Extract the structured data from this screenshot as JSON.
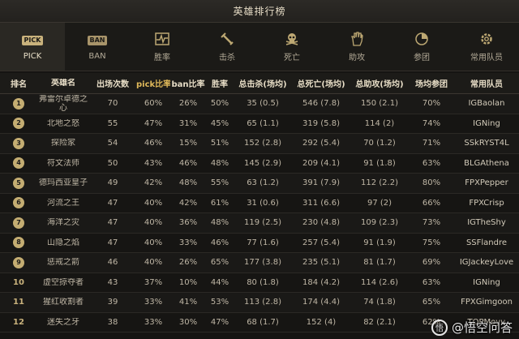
{
  "page_title": "英雄排行榜",
  "tabs": [
    {
      "label": "PICK",
      "icon": "pick-badge-icon",
      "badge": "PICK",
      "active": true
    },
    {
      "label": "BAN",
      "icon": "ban-badge-icon",
      "badge": "BAN",
      "active": false
    },
    {
      "label": "胜率",
      "icon": "pulse-chart-icon",
      "active": false
    },
    {
      "label": "击杀",
      "icon": "sword-icon",
      "active": false
    },
    {
      "label": "死亡",
      "icon": "skull-icon",
      "active": false
    },
    {
      "label": "助攻",
      "icon": "hand-icon",
      "active": false
    },
    {
      "label": "参团",
      "icon": "pie-chart-icon",
      "active": false
    },
    {
      "label": "常用队员",
      "icon": "gear-icon",
      "active": false
    }
  ],
  "table": {
    "headers": [
      "排名",
      "英雄名",
      "出场次数",
      "pick比率",
      "ban比率",
      "胜率",
      "总击杀(场均)",
      "总死亡(场均)",
      "总助攻(场均)",
      "场均参团",
      "常用队员"
    ],
    "rows": [
      {
        "rank": "1",
        "name": "弗雷尔卓德之心",
        "picks": "70",
        "pick_rate": "60%",
        "ban_rate": "26%",
        "win_rate": "50%",
        "kills": "35 (0.5)",
        "deaths": "546 (7.8)",
        "assists": "150 (2.1)",
        "participation": "70%",
        "team": "IGBaolan"
      },
      {
        "rank": "2",
        "name": "北地之怒",
        "picks": "55",
        "pick_rate": "47%",
        "ban_rate": "31%",
        "win_rate": "45%",
        "kills": "65 (1.1)",
        "deaths": "319 (5.8)",
        "assists": "114 (2)",
        "participation": "74%",
        "team": "IGNing"
      },
      {
        "rank": "3",
        "name": "探险家",
        "picks": "54",
        "pick_rate": "46%",
        "ban_rate": "15%",
        "win_rate": "51%",
        "kills": "152 (2.8)",
        "deaths": "292 (5.4)",
        "assists": "70 (1.2)",
        "participation": "71%",
        "team": "SSkRYST4L"
      },
      {
        "rank": "4",
        "name": "符文法师",
        "picks": "50",
        "pick_rate": "43%",
        "ban_rate": "46%",
        "win_rate": "48%",
        "kills": "145 (2.9)",
        "deaths": "209 (4.1)",
        "assists": "91 (1.8)",
        "participation": "63%",
        "team": "BLGAthena"
      },
      {
        "rank": "5",
        "name": "德玛西亚皇子",
        "picks": "49",
        "pick_rate": "42%",
        "ban_rate": "48%",
        "win_rate": "55%",
        "kills": "63 (1.2)",
        "deaths": "391 (7.9)",
        "assists": "112 (2.2)",
        "participation": "80%",
        "team": "FPXPepper"
      },
      {
        "rank": "6",
        "name": "河流之王",
        "picks": "47",
        "pick_rate": "40%",
        "ban_rate": "42%",
        "win_rate": "61%",
        "kills": "31 (0.6)",
        "deaths": "311 (6.6)",
        "assists": "97 (2)",
        "participation": "66%",
        "team": "FPXCrisp"
      },
      {
        "rank": "7",
        "name": "海洋之灾",
        "picks": "47",
        "pick_rate": "40%",
        "ban_rate": "36%",
        "win_rate": "48%",
        "kills": "119 (2.5)",
        "deaths": "230 (4.8)",
        "assists": "109 (2.3)",
        "participation": "73%",
        "team": "IGTheShy"
      },
      {
        "rank": "8",
        "name": "山隐之焰",
        "picks": "47",
        "pick_rate": "40%",
        "ban_rate": "33%",
        "win_rate": "46%",
        "kills": "77 (1.6)",
        "deaths": "257 (5.4)",
        "assists": "91 (1.9)",
        "participation": "75%",
        "team": "SSFlandre"
      },
      {
        "rank": "9",
        "name": "惩戒之箭",
        "picks": "46",
        "pick_rate": "40%",
        "ban_rate": "26%",
        "win_rate": "65%",
        "kills": "177 (3.8)",
        "deaths": "235 (5.1)",
        "assists": "81 (1.7)",
        "participation": "69%",
        "team": "IGJackeyLove"
      },
      {
        "rank": "10",
        "name": "虚空掠夺者",
        "picks": "43",
        "pick_rate": "37%",
        "ban_rate": "10%",
        "win_rate": "44%",
        "kills": "80 (1.8)",
        "deaths": "184 (4.2)",
        "assists": "114 (2.6)",
        "participation": "63%",
        "team": "IGNing"
      },
      {
        "rank": "11",
        "name": "猩红收割者",
        "picks": "39",
        "pick_rate": "33%",
        "ban_rate": "41%",
        "win_rate": "53%",
        "kills": "113 (2.8)",
        "deaths": "174 (4.4)",
        "assists": "74 (1.8)",
        "participation": "65%",
        "team": "FPXGimgoon"
      },
      {
        "rank": "12",
        "name": "迷失之牙",
        "picks": "38",
        "pick_rate": "33%",
        "ban_rate": "30%",
        "win_rate": "47%",
        "kills": "68 (1.7)",
        "deaths": "152 (4)",
        "assists": "82 (2.1)",
        "participation": "62%",
        "team": "TOPMoyu"
      }
    ]
  },
  "watermark": {
    "logo": "悟",
    "text": "@悟空问答"
  },
  "colors": {
    "accent": "#c4ad72",
    "highlight": "#e0b95a",
    "background": "#151412"
  }
}
